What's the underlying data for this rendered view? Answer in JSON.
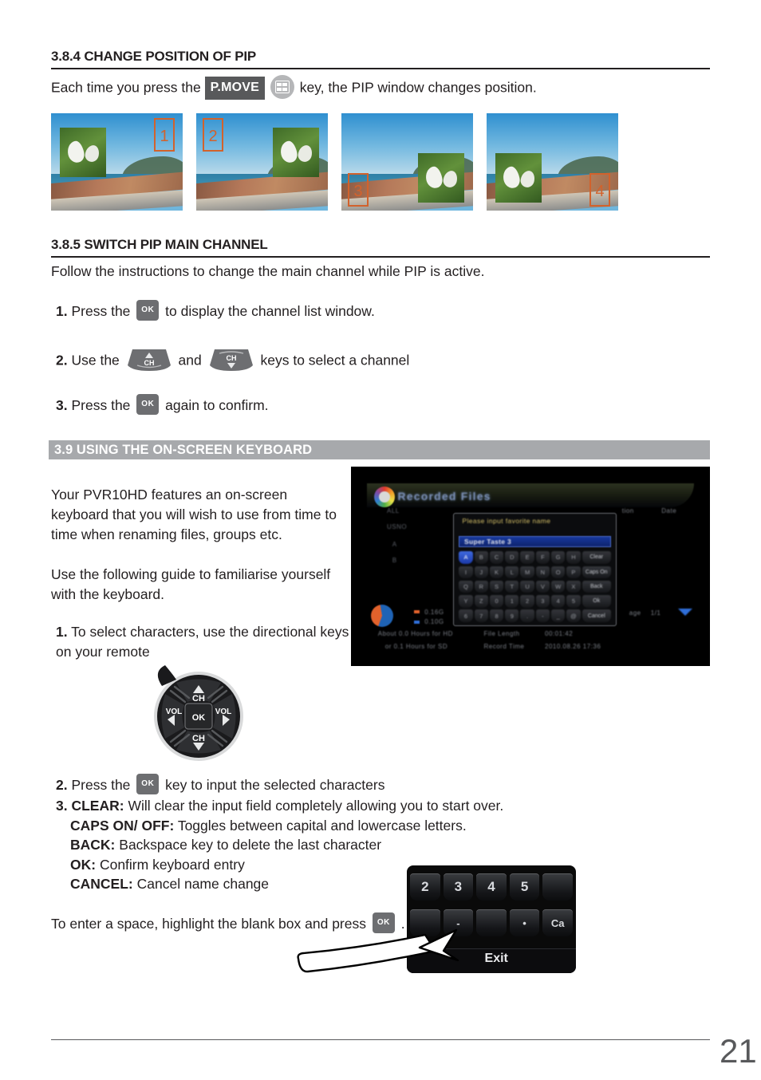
{
  "page": {
    "number": "21"
  },
  "section_384": {
    "title": "3.8.4 CHANGE POSITION OF PIP",
    "intro_before": "Each time you press the",
    "pmove_label": "P.MOVE",
    "pip_icon": "pip-grid-icon",
    "intro_after": "key, the PIP window changes position.",
    "thumbnails": [
      {
        "position_label": "1",
        "corner": "top-right"
      },
      {
        "position_label": "2",
        "corner": "top-left"
      },
      {
        "position_label": "3",
        "corner": "bottom-left"
      },
      {
        "position_label": "4",
        "corner": "bottom-right"
      }
    ]
  },
  "section_385": {
    "title": "3.8.5 SWITCH PIP MAIN CHANNEL",
    "intro": "Follow the instructions to change the main channel while PIP is active.",
    "steps": [
      {
        "num": "1.",
        "before": "Press the",
        "key": "OK",
        "after": "to display the channel list window."
      },
      {
        "num": "2.",
        "before": "Use the",
        "key_up": "CH",
        "conjunction": "and",
        "key_down": "CH",
        "after": "keys to select a channel"
      },
      {
        "num": "3.",
        "before": "Press the",
        "key": "OK",
        "after": "again to confirm."
      }
    ]
  },
  "section_39": {
    "band_title": "3.9 USING THE ON-SCREEN KEYBOARD",
    "para1": "Your PVR10HD features an on-screen keyboard that you will wish to use from time to time when renaming files, groups etc.",
    "para2": "Use the following guide to familiarise yourself with the keyboard.",
    "step1": {
      "num": "1.",
      "text": "To select characters, use the directional keys on your remote"
    },
    "step2": {
      "num": "2.",
      "before": "Press the",
      "key": "OK",
      "after": "key to input the selected characters"
    },
    "step3": {
      "num": "3.",
      "items": [
        {
          "term": "CLEAR:",
          "desc": "Will clear the input field completely allowing you to start over."
        },
        {
          "term": "CAPS ON/ OFF:",
          "desc": "Toggles between capital and lowercase letters."
        },
        {
          "term": "BACK:",
          "desc": "Backspace key to delete the last character"
        },
        {
          "term": "OK:",
          "desc": "Confirm keyboard entry"
        },
        {
          "term": "CANCEL:",
          "desc": "Cancel name change"
        }
      ]
    },
    "space_note": {
      "before": "To enter a space, highlight the blank box and press",
      "key": "OK",
      "after": "."
    }
  },
  "remote_dpad": {
    "up_label": "CH",
    "down_label": "CH",
    "left_label": "VOL",
    "right_label": "VOL",
    "center_label": "OK"
  },
  "tv_screenshot": {
    "title": "Recorded Files",
    "columns": [
      "tion",
      "Date"
    ],
    "left_items": [
      "ALL",
      "USNO",
      "A",
      "B"
    ],
    "dialog": {
      "prompt": "Please input favorite name",
      "input_value": "Super Taste 3",
      "rows": [
        [
          "A",
          "B",
          "C",
          "D",
          "E",
          "F",
          "G",
          "H",
          "Clear"
        ],
        [
          "I",
          "J",
          "K",
          "L",
          "M",
          "N",
          "O",
          "P",
          "Caps On"
        ],
        [
          "Q",
          "R",
          "S",
          "T",
          "U",
          "V",
          "W",
          "X",
          "Back"
        ],
        [
          "Y",
          "Z",
          "0",
          "1",
          "2",
          "3",
          "4",
          "5",
          "Ok"
        ],
        [
          "6",
          "7",
          "8",
          "9",
          ".",
          "-",
          "_",
          "@",
          "Cancel"
        ]
      ]
    },
    "footer": {
      "hd_line": "About 0.0 Hours for HD",
      "sd_line": "or 0.1 Hours for SD",
      "file_length_label": "File Length",
      "file_length_value": "00:01:42",
      "record_time_label": "Record Time",
      "record_time_value": "2010.08.26 17:36",
      "size_hd": "0.16G",
      "size_sd": "0.10G",
      "page_indicator": "1/1",
      "page_label": "age"
    }
  },
  "keyboard_closeup": {
    "number_keys": [
      "2",
      "3",
      "4",
      "5"
    ],
    "second_row": [
      "",
      "-",
      "",
      "•",
      "Ca"
    ],
    "exit_label": "Exit",
    "callout": "arrow-pointing-to-blank-space-key"
  },
  "colors": {
    "band_grey": "#a7a9ac",
    "key_grey": "#6d6e71",
    "tag_grey": "#58595b",
    "accent_orange": "#d2622c",
    "text": "#231f20"
  }
}
